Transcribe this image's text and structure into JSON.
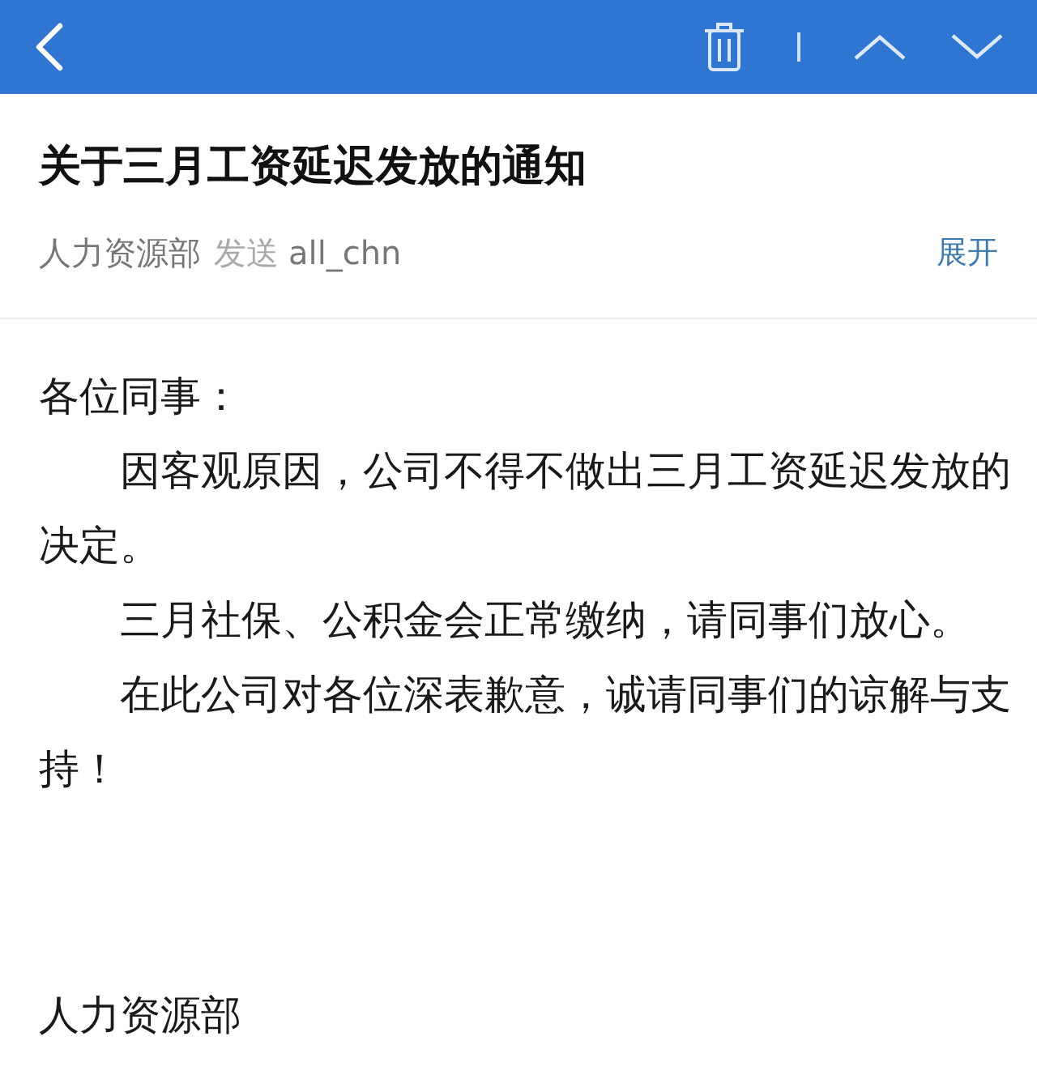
{
  "mail": {
    "subject": "关于三月工资延迟发放的通知",
    "sender": "人力资源部",
    "action": "发送",
    "recipient": "all_chn",
    "expand": "展开",
    "greeting": "各位同事：",
    "paragraphs": [
      "因客观原因，公司不得不做出三月工资延迟发放的决定。",
      "三月社保、公积金会正常缴纳，请同事们放心。",
      "在此公司对各位深表歉意，诚请同事们的谅解与支持！"
    ],
    "signature": "人力资源部"
  }
}
